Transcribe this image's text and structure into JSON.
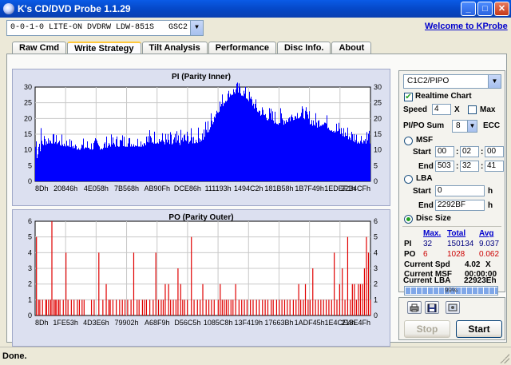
{
  "window": {
    "title": "K's CD/DVD Probe 1.1.29"
  },
  "toolbar": {
    "drive_select": "0-0-1-0 LITE-ON DVDRW LDW-851S   GSC2",
    "welcome_link": "Welcome to KProbe"
  },
  "tabs": [
    {
      "label": "Raw Cmd"
    },
    {
      "label": "Write Strategy"
    },
    {
      "label": "Tilt Analysis"
    },
    {
      "label": "Performance"
    },
    {
      "label": "Disc Info."
    },
    {
      "label": "About"
    }
  ],
  "active_tab": "Write Strategy",
  "settings": {
    "mode_select": "C1C2/PIPO",
    "realtime_label": "Realtime Chart",
    "realtime_checked": true,
    "speed_label": "Speed",
    "speed_value": "4",
    "speed_unit": "X",
    "max_label": "Max",
    "max_checked": false,
    "sum_label": "PI/PO Sum",
    "sum_value": "8",
    "ecc_label": "ECC",
    "msf_label": "MSF",
    "start_label": "Start",
    "end_label": "End",
    "msf_start": [
      "00",
      "02",
      "00"
    ],
    "msf_end": [
      "503",
      "32",
      "41"
    ],
    "lba_label": "LBA",
    "lba_start": "0",
    "lba_end": "2292BF",
    "lba_unit": "h",
    "disc_size_label": "Disc Size",
    "selected_range": "Disc Size"
  },
  "stats": {
    "headers": {
      "max": "Max.",
      "total": "Total",
      "avg": "Avg"
    },
    "pi": {
      "label": "PI",
      "max": "32",
      "total": "150134",
      "avg": "9.037"
    },
    "po": {
      "label": "PO",
      "max": "6",
      "total": "1028",
      "avg": "0.062"
    },
    "current_spd_label": "Current Spd",
    "current_spd_value": "4.02",
    "current_spd_unit": "X",
    "current_msf_label": "Current MSF",
    "current_msf_value": "00:00:00",
    "current_lba_label": "Current LBA",
    "current_lba_value": "22923Eh",
    "progress_percent": 99,
    "progress_text": "99%"
  },
  "buttons": {
    "print_icon": "printer-icon",
    "save_icon": "floppy-disk-icon",
    "screenshot_icon": "screenshot-icon",
    "stop": "Stop",
    "start": "Start",
    "stop_enabled": false
  },
  "statusbar": {
    "text": "Done."
  },
  "colors": {
    "pi_series": "#0000FF",
    "po_series": "#E00000",
    "chart_bg": "#FFFFFF",
    "frame_bg": "#DCE0F0"
  },
  "chart_data": [
    {
      "type": "bar",
      "title": "PI (Parity Inner)",
      "x_tick_labels": [
        "8Dh",
        "20846h",
        "4E058h",
        "7B568h",
        "AB90Fh",
        "DCE86h",
        "111193h",
        "1494C2h",
        "181B58h",
        "1B7F49h",
        "1EDEF1h",
        "2234CFh"
      ],
      "ylim": [
        0,
        30
      ],
      "y_ticks": [
        0,
        5,
        10,
        15,
        20,
        25,
        30
      ],
      "grid": true,
      "series": [
        {
          "values": [
            6,
            11,
            12,
            12,
            11,
            11,
            10,
            10,
            10,
            10,
            10,
            11,
            11,
            11,
            11,
            11,
            11,
            12,
            12,
            12,
            11,
            11,
            12,
            12,
            12,
            13,
            16,
            21,
            24,
            27,
            28,
            27,
            25,
            22,
            20,
            19,
            18,
            18,
            19,
            20,
            20,
            18,
            17,
            18,
            16,
            15,
            14,
            13,
            12,
            12,
            12
          ],
          "max_values": [
            30,
            17,
            16,
            15,
            15,
            14,
            13,
            14,
            14,
            14,
            14,
            15,
            15,
            16,
            15,
            15,
            16,
            17,
            17,
            16,
            16,
            16,
            17,
            17,
            17,
            19,
            22,
            27,
            29,
            30,
            32,
            31,
            29,
            26,
            25,
            24,
            23,
            24,
            24,
            25,
            24,
            23,
            22,
            22,
            21,
            20,
            19,
            18,
            17,
            17,
            20
          ]
        }
      ]
    },
    {
      "type": "bar",
      "title": "PO (Parity Outer)",
      "x_tick_labels": [
        "8Dh",
        "1FE53h",
        "4D3E6h",
        "79902h",
        "A68F9h",
        "D56C5h",
        "1085C8h",
        "13F419h",
        "17663Bh",
        "1ADF45h",
        "1E4CE4h",
        "218E4Fh"
      ],
      "ylim": [
        0,
        6
      ],
      "y_ticks": [
        0,
        1,
        2,
        3,
        4,
        5,
        6
      ],
      "grid": true,
      "series": [
        {
          "spikes": [
            [
              0.2,
              5
            ],
            [
              0.5,
              1
            ],
            [
              0.7,
              1
            ],
            [
              1.1,
              1
            ],
            [
              1.6,
              1
            ],
            [
              1.7,
              1
            ],
            [
              2.0,
              1
            ],
            [
              2.3,
              1
            ],
            [
              2.5,
              6
            ],
            [
              2.8,
              1
            ],
            [
              3.0,
              1
            ],
            [
              3.2,
              1
            ],
            [
              3.5,
              1
            ],
            [
              3.7,
              1
            ],
            [
              4.2,
              1
            ],
            [
              4.6,
              4
            ],
            [
              4.9,
              1
            ],
            [
              5.4,
              1
            ],
            [
              5.8,
              1
            ],
            [
              6.3,
              1
            ],
            [
              6.6,
              1
            ],
            [
              7.0,
              1
            ],
            [
              7.3,
              1
            ],
            [
              8.4,
              1
            ],
            [
              8.8,
              1
            ],
            [
              9.5,
              4
            ],
            [
              10.1,
              1
            ],
            [
              10.6,
              2
            ],
            [
              11.0,
              1
            ],
            [
              11.2,
              1
            ],
            [
              11.6,
              1
            ],
            [
              12.1,
              1
            ],
            [
              12.6,
              1
            ],
            [
              13.0,
              1
            ],
            [
              13.4,
              1
            ],
            [
              13.8,
              1
            ],
            [
              14.3,
              1
            ],
            [
              14.7,
              4
            ],
            [
              15.2,
              1
            ],
            [
              15.5,
              1
            ],
            [
              16.0,
              1
            ],
            [
              16.3,
              1
            ],
            [
              16.6,
              1
            ],
            [
              17.1,
              1
            ],
            [
              17.6,
              1
            ],
            [
              18.0,
              4
            ],
            [
              18.4,
              1
            ],
            [
              18.8,
              1
            ],
            [
              19.1,
              1
            ],
            [
              19.4,
              2
            ],
            [
              19.9,
              2
            ],
            [
              20.2,
              1
            ],
            [
              20.6,
              1
            ],
            [
              21.0,
              1
            ],
            [
              21.3,
              3
            ],
            [
              21.7,
              2
            ],
            [
              22.0,
              1
            ],
            [
              22.3,
              1
            ],
            [
              22.7,
              1
            ],
            [
              23.3,
              5
            ],
            [
              23.7,
              1
            ],
            [
              24.2,
              1
            ],
            [
              24.6,
              1
            ],
            [
              25.0,
              2
            ],
            [
              25.5,
              1
            ],
            [
              25.9,
              1
            ],
            [
              26.3,
              1
            ],
            [
              26.7,
              1
            ],
            [
              27.3,
              1
            ],
            [
              27.6,
              2
            ],
            [
              27.9,
              1
            ],
            [
              28.2,
              1
            ],
            [
              28.5,
              1
            ],
            [
              28.8,
              1
            ],
            [
              29.2,
              1
            ],
            [
              29.5,
              1
            ],
            [
              29.9,
              2
            ],
            [
              30.4,
              1
            ],
            [
              30.8,
              1
            ],
            [
              31.2,
              1
            ],
            [
              31.6,
              1
            ],
            [
              32.1,
              1
            ],
            [
              32.5,
              1
            ],
            [
              33.0,
              1
            ],
            [
              33.4,
              1
            ],
            [
              33.9,
              1
            ],
            [
              34.3,
              1
            ],
            [
              34.7,
              1
            ],
            [
              35.2,
              1
            ],
            [
              35.5,
              1
            ],
            [
              36.0,
              1
            ],
            [
              36.4,
              1
            ],
            [
              36.8,
              1
            ],
            [
              37.2,
              1
            ],
            [
              37.6,
              1
            ],
            [
              38.0,
              1
            ],
            [
              38.5,
              1
            ],
            [
              38.9,
              1
            ],
            [
              39.3,
              2
            ],
            [
              39.6,
              1
            ],
            [
              40.0,
              1
            ],
            [
              40.3,
              2
            ],
            [
              40.7,
              1
            ],
            [
              41.0,
              1
            ],
            [
              41.4,
              3
            ],
            [
              41.8,
              1
            ],
            [
              42.2,
              1
            ],
            [
              42.6,
              1
            ],
            [
              43.0,
              1
            ],
            [
              43.4,
              1
            ],
            [
              43.8,
              1
            ],
            [
              44.2,
              1
            ],
            [
              44.6,
              4
            ],
            [
              45.0,
              1
            ],
            [
              45.4,
              2
            ],
            [
              45.8,
              3
            ],
            [
              46.2,
              1
            ],
            [
              46.6,
              5
            ],
            [
              47.0,
              1
            ],
            [
              47.3,
              2
            ],
            [
              47.6,
              2
            ],
            [
              47.9,
              1
            ],
            [
              48.2,
              2
            ],
            [
              48.5,
              2
            ],
            [
              48.8,
              2
            ],
            [
              49.1,
              3
            ],
            [
              49.4,
              5
            ],
            [
              49.7,
              4
            ],
            [
              50.0,
              1
            ]
          ],
          "span": 50
        }
      ]
    }
  ]
}
